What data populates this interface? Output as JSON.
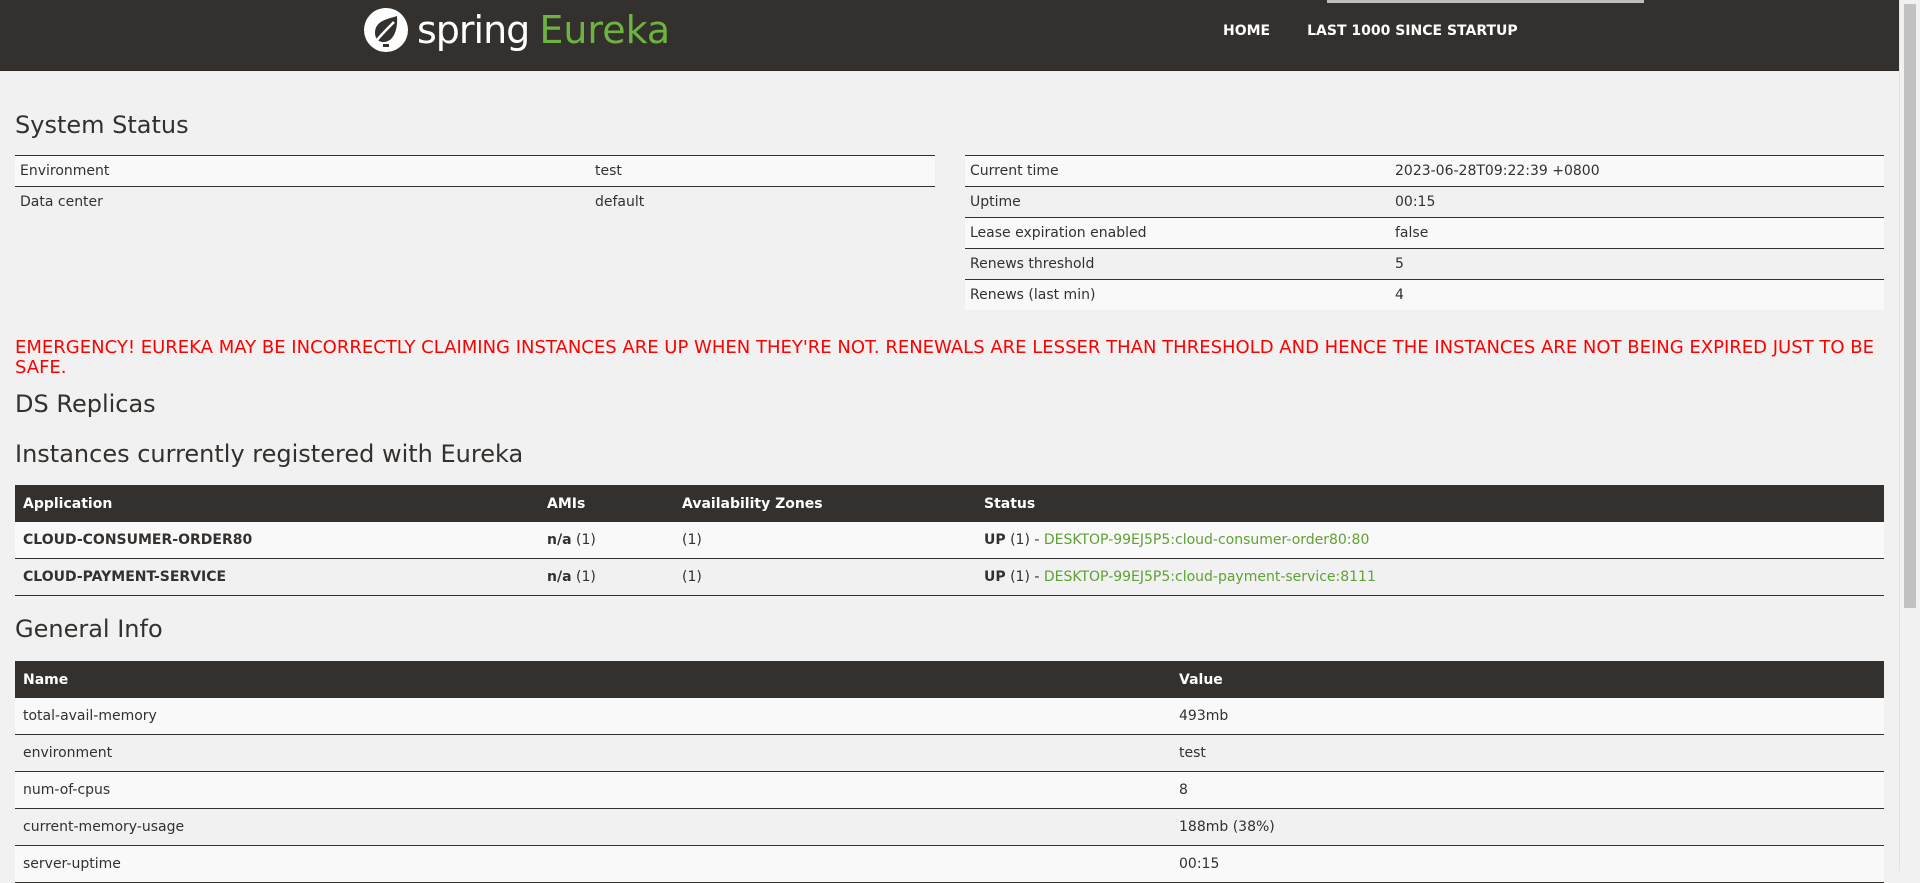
{
  "header": {
    "brand_spring": "spring",
    "brand_eureka": "Eureka",
    "nav": [
      "HOME",
      "LAST 1000 SINCE STARTUP"
    ]
  },
  "system_status": {
    "title": "System Status",
    "left": [
      {
        "label": "Environment",
        "value": "test"
      },
      {
        "label": "Data center",
        "value": "default"
      }
    ],
    "right": [
      {
        "label": "Current time",
        "value": "2023-06-28T09:22:39 +0800"
      },
      {
        "label": "Uptime",
        "value": "00:15"
      },
      {
        "label": "Lease expiration enabled",
        "value": "false"
      },
      {
        "label": "Renews threshold",
        "value": "5"
      },
      {
        "label": "Renews (last min)",
        "value": "4"
      }
    ]
  },
  "emergency": "EMERGENCY! EUREKA MAY BE INCORRECTLY CLAIMING INSTANCES ARE UP WHEN THEY'RE NOT. RENEWALS ARE LESSER THAN THRESHOLD AND HENCE THE INSTANCES ARE NOT BEING EXPIRED JUST TO BE SAFE.",
  "ds_replicas": {
    "title": "DS Replicas"
  },
  "instances": {
    "title": "Instances currently registered with Eureka",
    "columns": [
      "Application",
      "AMIs",
      "Availability Zones",
      "Status"
    ],
    "rows": [
      {
        "application": "CLOUD-CONSUMER-ORDER80",
        "ami_bold": "n/a",
        "ami_count": " (1)",
        "zones": "(1)",
        "status_bold": "UP",
        "status_count": " (1) - ",
        "instance_link": "DESKTOP-99EJ5P5:cloud-consumer-order80:80"
      },
      {
        "application": "CLOUD-PAYMENT-SERVICE",
        "ami_bold": "n/a",
        "ami_count": " (1)",
        "zones": "(1)",
        "status_bold": "UP",
        "status_count": " (1) - ",
        "instance_link": "DESKTOP-99EJ5P5:cloud-payment-service:8111"
      }
    ]
  },
  "general_info": {
    "title": "General Info",
    "columns": [
      "Name",
      "Value"
    ],
    "rows": [
      {
        "name": "total-avail-memory",
        "value": "493mb"
      },
      {
        "name": "environment",
        "value": "test"
      },
      {
        "name": "num-of-cpus",
        "value": "8"
      },
      {
        "name": "current-memory-usage",
        "value": "188mb (38%)"
      },
      {
        "name": "server-uptime",
        "value": "00:15"
      }
    ]
  },
  "colors": {
    "header_bg": "#34302d",
    "brand_green": "#6db33f",
    "emergency_red": "#ff0000",
    "link_green": "#5fa134"
  },
  "icons": {
    "logo": "spring-leaf-icon"
  }
}
